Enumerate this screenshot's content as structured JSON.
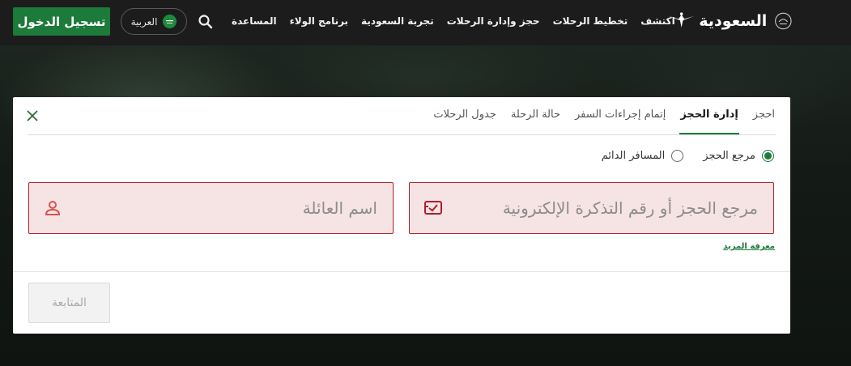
{
  "header": {
    "login_label": "تسجيل الدخول",
    "language_label": "العربية",
    "logo_text": "السعودية",
    "nav_items": [
      {
        "label": "اكتشف"
      },
      {
        "label": "تخطيط الرحلات"
      },
      {
        "label": "حجز وإدارة الرحلات"
      },
      {
        "label": "تجربة السعودية"
      },
      {
        "label": "برنامج الولاء"
      },
      {
        "label": "المساعدة"
      }
    ]
  },
  "card": {
    "tabs": [
      {
        "label": "احجز",
        "active": false
      },
      {
        "label": "إدارة الحجز",
        "active": true
      },
      {
        "label": "إتمام إجراءات السفر",
        "active": false
      },
      {
        "label": "حالة الرحلة",
        "active": false
      },
      {
        "label": "جدول الرحلات",
        "active": false
      }
    ],
    "radio_options": [
      {
        "label": "مرجع الحجز",
        "checked": true
      },
      {
        "label": "المسافر الدائم",
        "checked": false
      }
    ],
    "booking_ref_placeholder": "مرجع الحجز أو رقم التذكرة الإلكترونية",
    "last_name_placeholder": "اسم العائلة",
    "learn_more_label": "معرفة المزيد",
    "continue_label": "المتابعة"
  },
  "colors": {
    "brand_green": "#1c7a3a",
    "error_border": "#b01f2a",
    "error_bg": "#f6e3e4",
    "header_bg": "#1c1c1c"
  },
  "icons": {
    "search": "search-icon",
    "close": "close-icon",
    "ticket": "ticket-icon",
    "person": "person-icon",
    "logo": "saudia-falcon-icon"
  }
}
